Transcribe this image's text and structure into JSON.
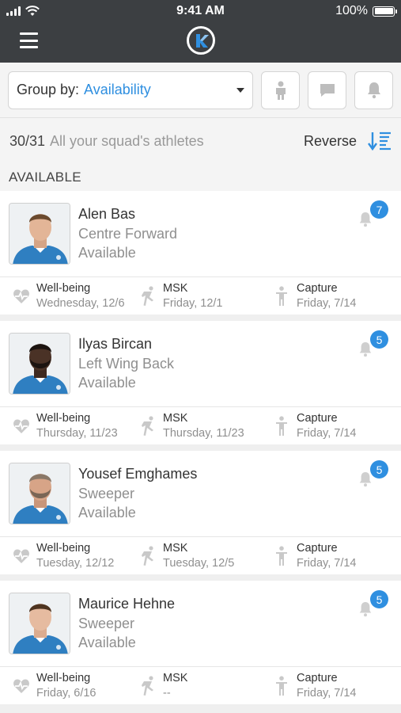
{
  "status": {
    "time": "9:41 AM",
    "battery": "100%"
  },
  "filter": {
    "group_by_label": "Group by:",
    "group_by_value": "Availability"
  },
  "count": {
    "number": "30/31",
    "text": "All your squad's athletes",
    "reverse_label": "Reverse"
  },
  "section": {
    "title": "AVAILABLE"
  },
  "athletes": [
    {
      "name": "Alen Bas",
      "position": "Centre Forward",
      "availability": "Available",
      "badge": "7",
      "metrics": [
        {
          "label": "Well-being",
          "date": "Wednesday, 12/6"
        },
        {
          "label": "MSK",
          "date": "Friday, 12/1"
        },
        {
          "label": "Capture",
          "date": "Friday, 7/14"
        }
      ]
    },
    {
      "name": "Ilyas Bircan",
      "position": "Left Wing Back",
      "availability": "Available",
      "badge": "5",
      "metrics": [
        {
          "label": "Well-being",
          "date": "Thursday, 11/23"
        },
        {
          "label": "MSK",
          "date": "Thursday, 11/23"
        },
        {
          "label": "Capture",
          "date": "Friday, 7/14"
        }
      ]
    },
    {
      "name": "Yousef Emghames",
      "position": "Sweeper",
      "availability": "Available",
      "badge": "5",
      "metrics": [
        {
          "label": "Well-being",
          "date": "Tuesday, 12/12"
        },
        {
          "label": "MSK",
          "date": "Tuesday, 12/5"
        },
        {
          "label": "Capture",
          "date": "Friday, 7/14"
        }
      ]
    },
    {
      "name": "Maurice Hehne",
      "position": "Sweeper",
      "availability": "Available",
      "badge": "5",
      "metrics": [
        {
          "label": "Well-being",
          "date": "Friday, 6/16"
        },
        {
          "label": "MSK",
          "date": "--"
        },
        {
          "label": "Capture",
          "date": "Friday, 7/14"
        }
      ]
    }
  ],
  "colors": {
    "accent": "#2f8fe0",
    "topbar": "#3c3f42"
  },
  "icons": {
    "metric_icons": [
      "heart-pulse-icon",
      "kicking-leg-icon",
      "person-standing-icon"
    ]
  }
}
